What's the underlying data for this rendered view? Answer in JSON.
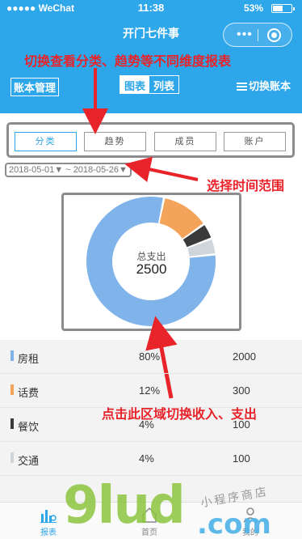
{
  "status_bar": {
    "carrier": "●●●●● WeChat",
    "time": "11:38",
    "battery": "53%",
    "battery_level": 0.53
  },
  "nav": {
    "title": "开门七件事",
    "capsule_more": "•••"
  },
  "annotations": {
    "top": "切换查看分类、趋势等不同维度报表",
    "time_range": "选择时间范围",
    "toggle": "点击此区域切换收入、支出"
  },
  "toolbar": {
    "book_manage": "账本管理",
    "view_chart": "图表",
    "view_list": "列表",
    "switch_book": "切换账本"
  },
  "tabs": [
    {
      "label": "分类",
      "active": true
    },
    {
      "label": "趋势",
      "active": false
    },
    {
      "label": "成员",
      "active": false
    },
    {
      "label": "账户",
      "active": false
    }
  ],
  "date_range": "2018-05-01▼ ~ 2018-05-26▼",
  "chart_data": {
    "type": "pie",
    "center_label": "总支出",
    "center_value": "2500",
    "slices": [
      {
        "name": "房租",
        "value": 2000,
        "percent": 80,
        "color": "#7fb3ea"
      },
      {
        "name": "话费",
        "value": 300,
        "percent": 12,
        "color": "#f4a35b"
      },
      {
        "name": "餐饮",
        "value": 100,
        "percent": 4,
        "color": "#3a3a3a"
      },
      {
        "name": "交通",
        "value": 100,
        "percent": 4,
        "color": "#cfd6db"
      }
    ]
  },
  "list": [
    {
      "name": "房租",
      "pct": "80%",
      "amount": "2000",
      "color": "#7fb3ea"
    },
    {
      "name": "话费",
      "pct": "12%",
      "amount": "300",
      "color": "#f4a35b"
    },
    {
      "name": "餐饮",
      "pct": "4%",
      "amount": "100",
      "color": "#3a3a3a"
    },
    {
      "name": "交通",
      "pct": "4%",
      "amount": "100",
      "color": "#cfd6db"
    }
  ],
  "tabbar": [
    {
      "label": "报表",
      "icon": "chart-icon",
      "active": true
    },
    {
      "label": "首页",
      "icon": "home-icon",
      "active": false
    },
    {
      "label": "我的",
      "icon": "user-icon",
      "active": false
    }
  ],
  "watermark": {
    "main": "9lud",
    "com": ".com",
    "small": "小程序商店"
  },
  "colors": {
    "primary": "#2ea6ea",
    "annotation": "#e8232a"
  }
}
